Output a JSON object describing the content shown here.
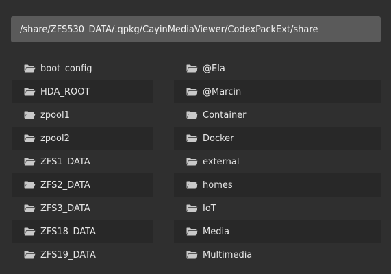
{
  "path_bar": {
    "path": "/share/ZFS530_DATA/.qpkg/CayinMediaViewer/CodexPackExt/share"
  },
  "folder_icon": "folder-open-icon",
  "colors": {
    "background": "#2f2f2f",
    "path_bar": "#5a5a5a",
    "row_shade": "#282828",
    "text": "#e6e6e6",
    "icon": "#c9c9c9"
  },
  "left_column": [
    {
      "label": "boot_config"
    },
    {
      "label": "HDA_ROOT"
    },
    {
      "label": "zpool1"
    },
    {
      "label": "zpool2"
    },
    {
      "label": "ZFS1_DATA"
    },
    {
      "label": "ZFS2_DATA"
    },
    {
      "label": "ZFS3_DATA"
    },
    {
      "label": "ZFS18_DATA"
    },
    {
      "label": "ZFS19_DATA"
    }
  ],
  "right_column": [
    {
      "label": "@Ela"
    },
    {
      "label": "@Marcin"
    },
    {
      "label": "Container"
    },
    {
      "label": "Docker"
    },
    {
      "label": "external"
    },
    {
      "label": "homes"
    },
    {
      "label": "IoT"
    },
    {
      "label": "Media"
    },
    {
      "label": "Multimedia"
    }
  ]
}
